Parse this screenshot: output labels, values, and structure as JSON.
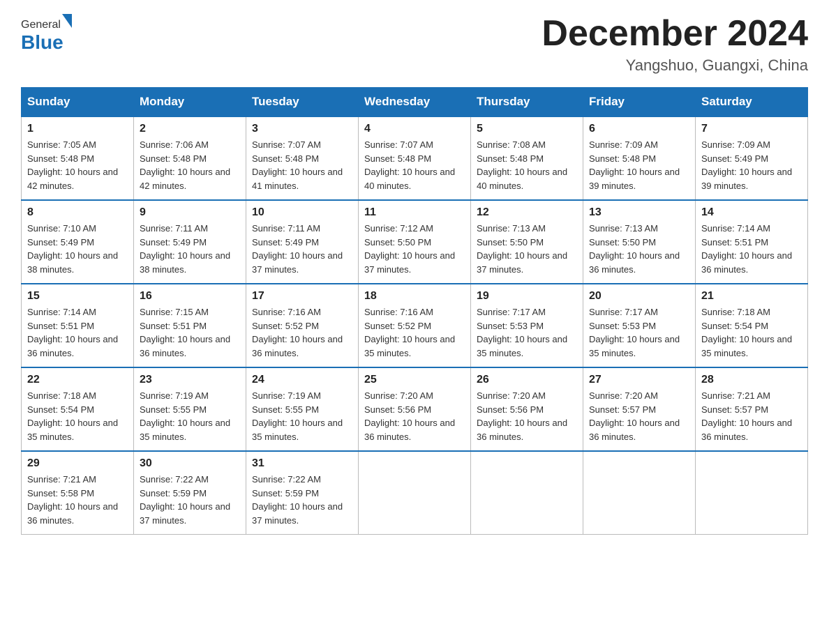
{
  "logo": {
    "general": "General",
    "blue": "Blue"
  },
  "title": "December 2024",
  "subtitle": "Yangshuo, Guangxi, China",
  "weekdays": [
    "Sunday",
    "Monday",
    "Tuesday",
    "Wednesday",
    "Thursday",
    "Friday",
    "Saturday"
  ],
  "weeks": [
    [
      {
        "day": "1",
        "sunrise": "Sunrise: 7:05 AM",
        "sunset": "Sunset: 5:48 PM",
        "daylight": "Daylight: 10 hours and 42 minutes."
      },
      {
        "day": "2",
        "sunrise": "Sunrise: 7:06 AM",
        "sunset": "Sunset: 5:48 PM",
        "daylight": "Daylight: 10 hours and 42 minutes."
      },
      {
        "day": "3",
        "sunrise": "Sunrise: 7:07 AM",
        "sunset": "Sunset: 5:48 PM",
        "daylight": "Daylight: 10 hours and 41 minutes."
      },
      {
        "day": "4",
        "sunrise": "Sunrise: 7:07 AM",
        "sunset": "Sunset: 5:48 PM",
        "daylight": "Daylight: 10 hours and 40 minutes."
      },
      {
        "day": "5",
        "sunrise": "Sunrise: 7:08 AM",
        "sunset": "Sunset: 5:48 PM",
        "daylight": "Daylight: 10 hours and 40 minutes."
      },
      {
        "day": "6",
        "sunrise": "Sunrise: 7:09 AM",
        "sunset": "Sunset: 5:48 PM",
        "daylight": "Daylight: 10 hours and 39 minutes."
      },
      {
        "day": "7",
        "sunrise": "Sunrise: 7:09 AM",
        "sunset": "Sunset: 5:49 PM",
        "daylight": "Daylight: 10 hours and 39 minutes."
      }
    ],
    [
      {
        "day": "8",
        "sunrise": "Sunrise: 7:10 AM",
        "sunset": "Sunset: 5:49 PM",
        "daylight": "Daylight: 10 hours and 38 minutes."
      },
      {
        "day": "9",
        "sunrise": "Sunrise: 7:11 AM",
        "sunset": "Sunset: 5:49 PM",
        "daylight": "Daylight: 10 hours and 38 minutes."
      },
      {
        "day": "10",
        "sunrise": "Sunrise: 7:11 AM",
        "sunset": "Sunset: 5:49 PM",
        "daylight": "Daylight: 10 hours and 37 minutes."
      },
      {
        "day": "11",
        "sunrise": "Sunrise: 7:12 AM",
        "sunset": "Sunset: 5:50 PM",
        "daylight": "Daylight: 10 hours and 37 minutes."
      },
      {
        "day": "12",
        "sunrise": "Sunrise: 7:13 AM",
        "sunset": "Sunset: 5:50 PM",
        "daylight": "Daylight: 10 hours and 37 minutes."
      },
      {
        "day": "13",
        "sunrise": "Sunrise: 7:13 AM",
        "sunset": "Sunset: 5:50 PM",
        "daylight": "Daylight: 10 hours and 36 minutes."
      },
      {
        "day": "14",
        "sunrise": "Sunrise: 7:14 AM",
        "sunset": "Sunset: 5:51 PM",
        "daylight": "Daylight: 10 hours and 36 minutes."
      }
    ],
    [
      {
        "day": "15",
        "sunrise": "Sunrise: 7:14 AM",
        "sunset": "Sunset: 5:51 PM",
        "daylight": "Daylight: 10 hours and 36 minutes."
      },
      {
        "day": "16",
        "sunrise": "Sunrise: 7:15 AM",
        "sunset": "Sunset: 5:51 PM",
        "daylight": "Daylight: 10 hours and 36 minutes."
      },
      {
        "day": "17",
        "sunrise": "Sunrise: 7:16 AM",
        "sunset": "Sunset: 5:52 PM",
        "daylight": "Daylight: 10 hours and 36 minutes."
      },
      {
        "day": "18",
        "sunrise": "Sunrise: 7:16 AM",
        "sunset": "Sunset: 5:52 PM",
        "daylight": "Daylight: 10 hours and 35 minutes."
      },
      {
        "day": "19",
        "sunrise": "Sunrise: 7:17 AM",
        "sunset": "Sunset: 5:53 PM",
        "daylight": "Daylight: 10 hours and 35 minutes."
      },
      {
        "day": "20",
        "sunrise": "Sunrise: 7:17 AM",
        "sunset": "Sunset: 5:53 PM",
        "daylight": "Daylight: 10 hours and 35 minutes."
      },
      {
        "day": "21",
        "sunrise": "Sunrise: 7:18 AM",
        "sunset": "Sunset: 5:54 PM",
        "daylight": "Daylight: 10 hours and 35 minutes."
      }
    ],
    [
      {
        "day": "22",
        "sunrise": "Sunrise: 7:18 AM",
        "sunset": "Sunset: 5:54 PM",
        "daylight": "Daylight: 10 hours and 35 minutes."
      },
      {
        "day": "23",
        "sunrise": "Sunrise: 7:19 AM",
        "sunset": "Sunset: 5:55 PM",
        "daylight": "Daylight: 10 hours and 35 minutes."
      },
      {
        "day": "24",
        "sunrise": "Sunrise: 7:19 AM",
        "sunset": "Sunset: 5:55 PM",
        "daylight": "Daylight: 10 hours and 35 minutes."
      },
      {
        "day": "25",
        "sunrise": "Sunrise: 7:20 AM",
        "sunset": "Sunset: 5:56 PM",
        "daylight": "Daylight: 10 hours and 36 minutes."
      },
      {
        "day": "26",
        "sunrise": "Sunrise: 7:20 AM",
        "sunset": "Sunset: 5:56 PM",
        "daylight": "Daylight: 10 hours and 36 minutes."
      },
      {
        "day": "27",
        "sunrise": "Sunrise: 7:20 AM",
        "sunset": "Sunset: 5:57 PM",
        "daylight": "Daylight: 10 hours and 36 minutes."
      },
      {
        "day": "28",
        "sunrise": "Sunrise: 7:21 AM",
        "sunset": "Sunset: 5:57 PM",
        "daylight": "Daylight: 10 hours and 36 minutes."
      }
    ],
    [
      {
        "day": "29",
        "sunrise": "Sunrise: 7:21 AM",
        "sunset": "Sunset: 5:58 PM",
        "daylight": "Daylight: 10 hours and 36 minutes."
      },
      {
        "day": "30",
        "sunrise": "Sunrise: 7:22 AM",
        "sunset": "Sunset: 5:59 PM",
        "daylight": "Daylight: 10 hours and 37 minutes."
      },
      {
        "day": "31",
        "sunrise": "Sunrise: 7:22 AM",
        "sunset": "Sunset: 5:59 PM",
        "daylight": "Daylight: 10 hours and 37 minutes."
      },
      null,
      null,
      null,
      null
    ]
  ]
}
